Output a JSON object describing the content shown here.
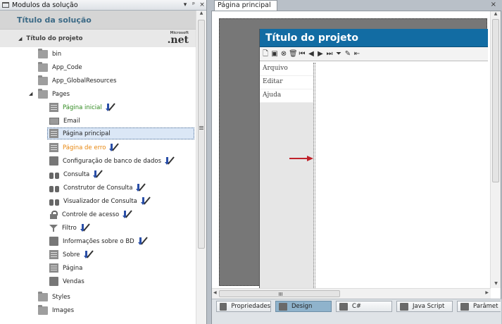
{
  "left_panel": {
    "title": "Modulos da solução",
    "controls": [
      "▾",
      "ᵖ",
      "×"
    ],
    "solution_title": "Título da solução",
    "project_title": "Título do projeto",
    "net_logo_small": "Microsoft",
    "net_logo": ".net",
    "tree": {
      "bin": "bin",
      "app_code": "App_Code",
      "app_global": "App_GlobalResources",
      "pages": "Pages",
      "pagina_inicial": "Página inicial",
      "email": "Email",
      "pagina_principal": "Página principal",
      "pagina_erro": "Página de erro",
      "config_bd": "Configuração de banco de dados",
      "consulta": "Consulta",
      "construtor": "Construtor de Consulta",
      "visualizador": "Visualizador de Consulta",
      "controle_acesso": "Controle de acesso",
      "filtro": "Filtro",
      "info_bd": "Informações sobre o BD",
      "sobre": "Sobre",
      "pagina": "Página",
      "vendas": "Vendas",
      "styles": "Styles",
      "images": "Images"
    },
    "colors": {
      "green_item": "#2f8a1f",
      "orange_item": "#e8870f"
    }
  },
  "document": {
    "tab_label": "Página principal",
    "close": "×",
    "app_title": "Título do projeto",
    "menu": [
      "Arquivo",
      "Editar",
      "Ajuda"
    ],
    "toolbar_icons": [
      "new-icon",
      "save-icon",
      "cancel-icon",
      "delete-icon",
      "first-icon",
      "prev-icon",
      "next-icon",
      "last-icon",
      "filter-icon",
      "edit-icon",
      "exit-icon"
    ],
    "accent": "#126ca3"
  },
  "bottom_tabs": {
    "propriedades": "Propriedades",
    "design": "Design",
    "csharp": "C#",
    "javascript": "Java Script",
    "parametros": "Parâmet"
  }
}
